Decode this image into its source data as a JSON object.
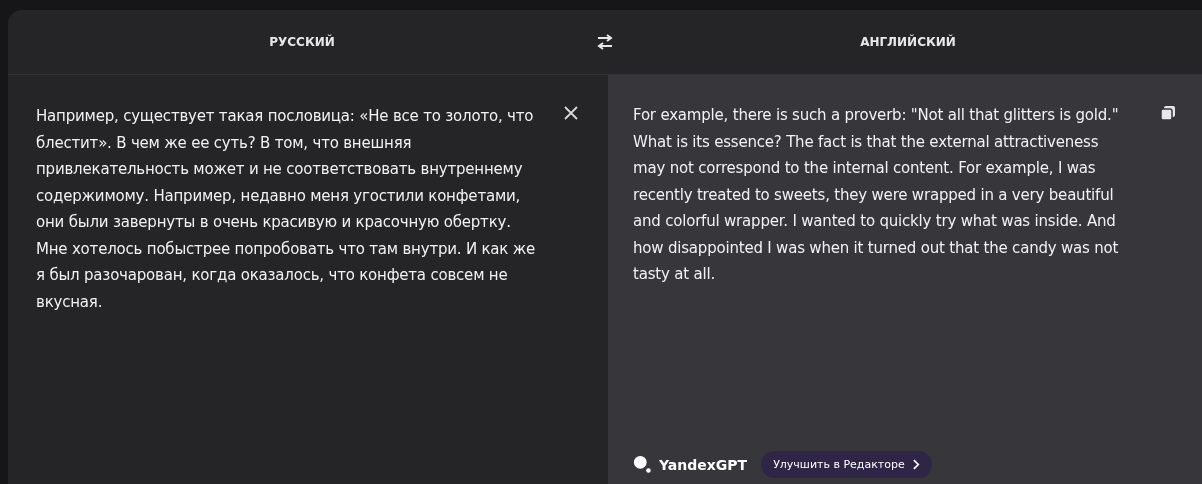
{
  "languages": {
    "source": "РУССКИЙ",
    "target": "АНГЛИЙСКИЙ"
  },
  "source_text": "Например, существует такая пословица: «Не все то золото, что блестит». В чем же ее суть? В том, что внешняя привлекательность может и не соответствовать внутреннему содержимому. Например, недавно меня угостили конфетами, они были завернуты в очень красивую и красочную обертку. Мне хотелось побыстрее попробовать что там внутри. И как же я был разочарован, когда оказалось, что конфета совсем не вкусная.",
  "translation": "For example, there is such a proverb: \"Not all that glitters is gold.\" What is its essence? The fact is that the external attractiveness may not correspond to the internal content. For example, I was recently treated to sweets, they were wrapped in a very beautiful and colorful wrapper. I wanted to quickly try what was inside. And how disappointed I was when it turned out that the candy was not tasty at all.",
  "footer": {
    "brand": "YandexGPT",
    "improve_button": "Улучшить в Редакторе"
  }
}
